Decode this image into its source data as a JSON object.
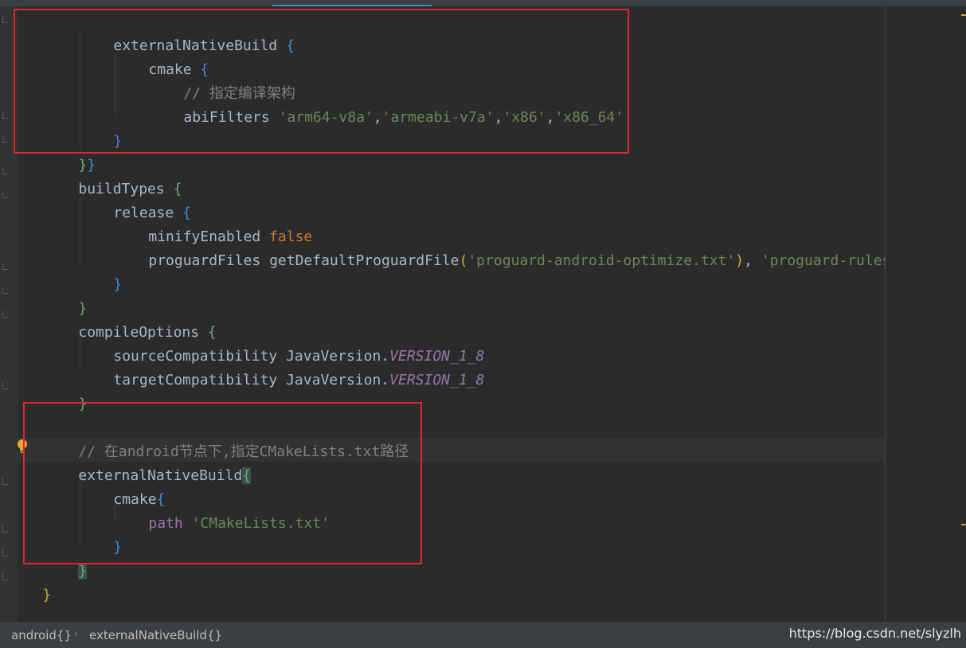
{
  "editor": {
    "l1": {
      "kw": "externalNativeBuild",
      "b": "{"
    },
    "l2": {
      "kw": "cmake",
      "b": "{"
    },
    "l3": {
      "comment": "// 指定编译架构"
    },
    "l4": {
      "kw": "abiFilters ",
      "s1": "'arm64-v8a'",
      "s2": "'armeabi-v7a'",
      "s3": "'x86'",
      "s4": "'x86_64'",
      "sep": ","
    },
    "l5": {
      "b": "}"
    },
    "l6": {
      "b1": "}",
      "b2": "}"
    },
    "l7": {
      "kw": "buildTypes",
      "b": "{"
    },
    "l8": {
      "kw": "release",
      "b": "{"
    },
    "l9": {
      "kw": "minifyEnabled ",
      "val": "false"
    },
    "l10": {
      "kw": "proguardFiles ",
      "fn": "getDefaultProguardFile",
      "po": "(",
      "s1": "'proguard-android-optimize.txt'",
      "pc": ")",
      "sep": ", ",
      "s2": "'proguard-rules.pro'"
    },
    "l11": {
      "b": "}"
    },
    "l12": {
      "b": "}"
    },
    "l13": {
      "kw": "compileOptions",
      "b": "{"
    },
    "l14": {
      "kw": "sourceCompatibility JavaVersion.",
      "field": "VERSION_1_8"
    },
    "l15": {
      "kw": "targetCompatibility JavaVersion.",
      "field": "VERSION_1_8"
    },
    "l16": {
      "b": "}"
    },
    "l18": {
      "comment": "// 在android节点下,指定CMakeLists.txt路径"
    },
    "l19": {
      "kw": "externalNativeBuild",
      "b": "{"
    },
    "l20": {
      "kw": "cmake",
      "b": "{"
    },
    "l21": {
      "kw": "path",
      "s": "'CMakeLists.txt'"
    },
    "l22": {
      "b": "}"
    },
    "l23": {
      "b": "}"
    },
    "l24": {
      "b": "}"
    }
  },
  "status": {
    "crumb1": "android{}",
    "sep": "›",
    "crumb2": "externalNativeBuild{}",
    "watermark": "https://blog.csdn.net/slyzlh"
  },
  "colors": {
    "background": "#2b2b2b",
    "highlight_box": "#e0262e",
    "string": "#6a8759",
    "keyword": "#cc7832",
    "comment": "#808080",
    "field": "#9876aa"
  },
  "icons": {
    "gutter_hint": "lightbulb-icon"
  }
}
